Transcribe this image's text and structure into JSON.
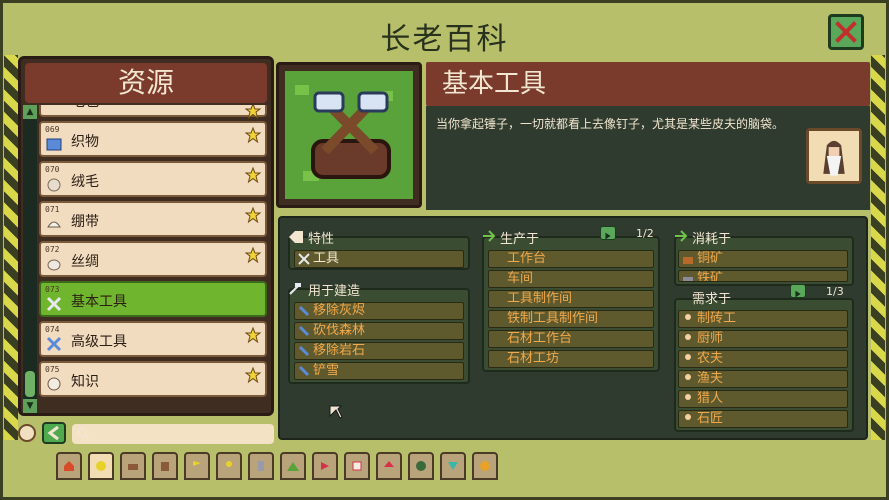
{
  "window": {
    "title": "长老百科"
  },
  "left_panel": {
    "title": "资源",
    "items": [
      {
        "num": "",
        "label": "毛毯",
        "starred": true
      },
      {
        "num": "069",
        "label": "织物",
        "starred": true
      },
      {
        "num": "070",
        "label": "绒毛",
        "starred": true
      },
      {
        "num": "071",
        "label": "绷带",
        "starred": true
      },
      {
        "num": "072",
        "label": "丝绸",
        "starred": true
      },
      {
        "num": "073",
        "label": "基本工具",
        "starred": false,
        "selected": true
      },
      {
        "num": "074",
        "label": "高级工具",
        "starred": true
      },
      {
        "num": "075",
        "label": "知识",
        "starred": true
      }
    ],
    "search": {
      "placeholder": ""
    }
  },
  "detail": {
    "title": "基本工具",
    "description": "当你拿起锤子，一切就都看上去像钉子，尤其是某些皮夫的脑袋。"
  },
  "traits": {
    "title": "特性",
    "items": [
      "工具"
    ]
  },
  "used_for": {
    "title": "用于建造",
    "items": [
      "移除灰烬",
      "砍伐森林",
      "移除岩石",
      "铲雪"
    ]
  },
  "produced_in": {
    "title": "生产于",
    "page": "1/2",
    "items": [
      "工作台",
      "车间",
      "工具制作间",
      "铁制工具制作间",
      "石材工作台",
      "石材工坊"
    ]
  },
  "consumed_by": {
    "title": "消耗于",
    "items": [
      "铜矿",
      "铁矿"
    ]
  },
  "required_by": {
    "title": "需求于",
    "page": "1/3",
    "items": [
      "制砖工",
      "厨师",
      "农夫",
      "渔夫",
      "猎人",
      "石匠"
    ]
  },
  "colors": {
    "frame": "#b7bf6a",
    "header": "#7a3a2c",
    "selected": "#6fb62e",
    "panel": "#2f3b2e"
  }
}
